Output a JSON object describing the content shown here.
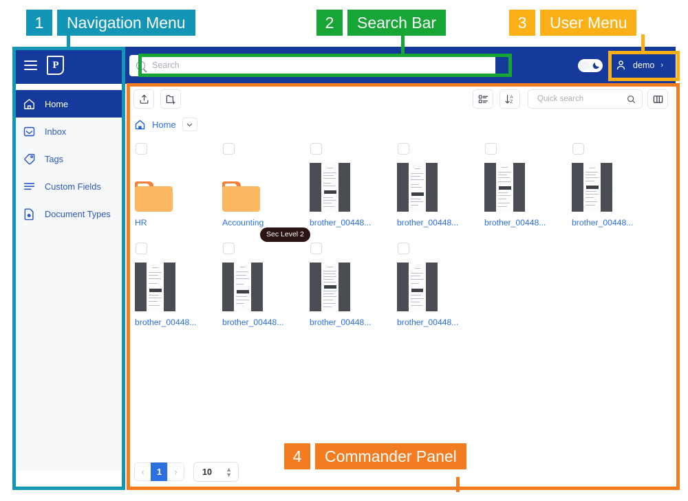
{
  "annotations": [
    {
      "num": "1",
      "label": "Navigation Menu",
      "color": "#1395b5"
    },
    {
      "num": "2",
      "label": "Search Bar",
      "color": "#17a535"
    },
    {
      "num": "3",
      "label": "User Menu",
      "color": "#fbb018"
    },
    {
      "num": "4",
      "label": "Commander Panel",
      "color": "#f47c20"
    }
  ],
  "navbar": {
    "menu_icon": "hamburger-icon",
    "logo_text": "P",
    "logo_icon": "paperless-logo",
    "search": {
      "placeholder": "Search",
      "value": "",
      "icon": "search-icon"
    },
    "theme_toggle": {
      "state": "off",
      "icon": "moon-icon"
    },
    "user": {
      "name": "demo",
      "icon": "user-icon",
      "caret": "›"
    }
  },
  "sidebar": {
    "items": [
      {
        "label": "Home",
        "icon": "home-icon",
        "active": true
      },
      {
        "label": "Inbox",
        "icon": "inbox-icon",
        "active": false
      },
      {
        "label": "Tags",
        "icon": "tag-icon",
        "active": false
      },
      {
        "label": "Custom Fields",
        "icon": "list-lines-icon",
        "active": false
      },
      {
        "label": "Document Types",
        "icon": "document-type-icon",
        "active": false
      }
    ]
  },
  "commander": {
    "toolbar": {
      "upload_icon": "upload-icon",
      "new_folder_icon": "new-folder-icon",
      "details_icon": "list-details-icon",
      "sort_icon": "sort-az-icon",
      "quick_search": {
        "placeholder": "Quick search",
        "value": "",
        "icon": "search-icon"
      },
      "view_toggle_icon": "split-view-icon"
    },
    "breadcrumb": {
      "home_icon": "home-icon",
      "label": "Home",
      "caret_icon": "chevron-down-icon"
    },
    "tooltip": {
      "text": "Sec Level 2"
    },
    "rows": [
      [
        {
          "type": "folder",
          "label": "HR"
        },
        {
          "type": "folder",
          "label": "Accounting"
        },
        {
          "type": "document",
          "label": "brother_00448..."
        },
        {
          "type": "document",
          "label": "brother_00448..."
        },
        {
          "type": "document",
          "label": "brother_00448..."
        },
        {
          "type": "document",
          "label": "brother_00448..."
        }
      ],
      [
        {
          "type": "document",
          "label": "brother_00448..."
        },
        {
          "type": "document",
          "label": "brother_00448..."
        },
        {
          "type": "document",
          "label": "brother_00448..."
        },
        {
          "type": "document",
          "label": "brother_00448..."
        }
      ]
    ],
    "pagination": {
      "prev": "‹",
      "pages": [
        "1"
      ],
      "next": "›",
      "current_page": "1",
      "page_size": "10",
      "stepper_icon": "updown-arrows-icon"
    }
  }
}
